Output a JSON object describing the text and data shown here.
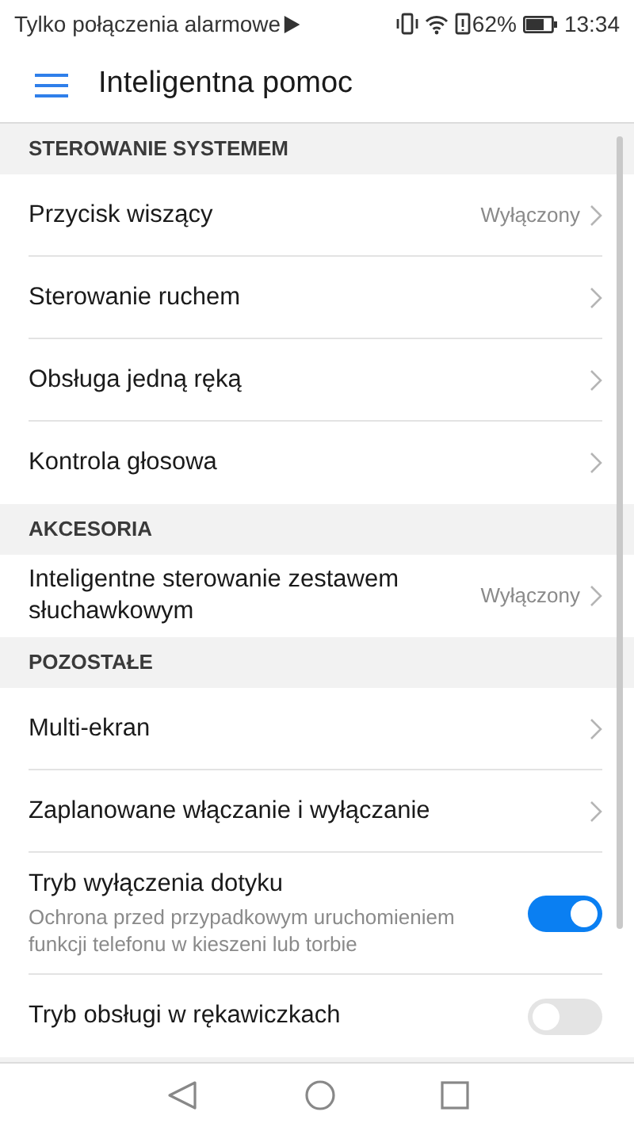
{
  "status_bar": {
    "notice": "Tylko połączenia alarmowe",
    "battery": "62%",
    "time": "13:34"
  },
  "app_bar": {
    "title": "Inteligentna pomoc"
  },
  "sections": [
    {
      "title": "STEROWANIE SYSTEMEM",
      "items": [
        {
          "kind": "link",
          "label": "Przycisk wiszący",
          "value": "Wyłączony"
        },
        {
          "kind": "link",
          "label": "Sterowanie ruchem"
        },
        {
          "kind": "link",
          "label": "Obsługa jedną ręką"
        },
        {
          "kind": "link",
          "label": "Kontrola głosowa"
        }
      ]
    },
    {
      "title": "AKCESORIA",
      "items": [
        {
          "kind": "link",
          "label": "Inteligentne sterowanie zestawem słuchawkowym",
          "value": "Wyłączony"
        }
      ]
    },
    {
      "title": "POZOSTAŁE",
      "items": [
        {
          "kind": "link",
          "label": "Multi-ekran"
        },
        {
          "kind": "link",
          "label": "Zaplanowane włączanie i wyłączanie"
        },
        {
          "kind": "switch",
          "label": "Tryb wyłączenia dotyku",
          "description": "Ochrona przed przypadkowym uruchomieniem funkcji telefonu w kieszeni lub torbie",
          "on": true
        },
        {
          "kind": "switch",
          "label": "Tryb obsługi w rękawiczkach",
          "on": false
        }
      ]
    }
  ]
}
